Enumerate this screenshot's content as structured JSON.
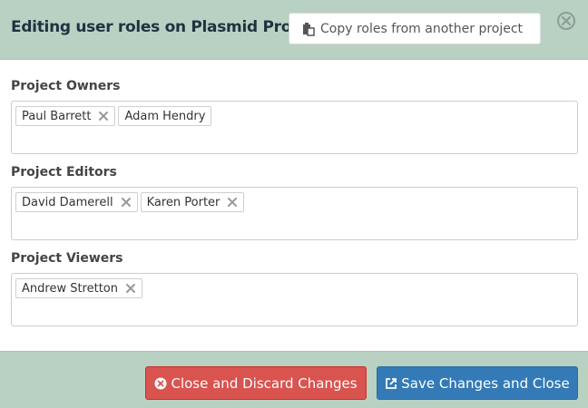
{
  "header": {
    "title": "Editing user roles on Plasmid Project",
    "copy_button_label": "Copy roles from another project",
    "copy_icon": "paste-icon",
    "close_icon": "close-circle-icon"
  },
  "roles": [
    {
      "label": "Project Owners",
      "users": [
        "Paul Barrett",
        "Adam Hendry"
      ]
    },
    {
      "label": "Project Editors",
      "users": [
        "David Damerell",
        "Karen Porter"
      ]
    },
    {
      "label": "Project Viewers",
      "users": [
        "Andrew Stretton"
      ]
    }
  ],
  "footer": {
    "discard_label": "Close and Discard Changes",
    "discard_icon": "times-circle-icon",
    "save_label": "Save Changes and Close",
    "save_icon": "share-square-icon"
  },
  "colors": {
    "header_bg": "#b9d1c3",
    "danger": "#d9534f",
    "primary": "#337ab7"
  }
}
